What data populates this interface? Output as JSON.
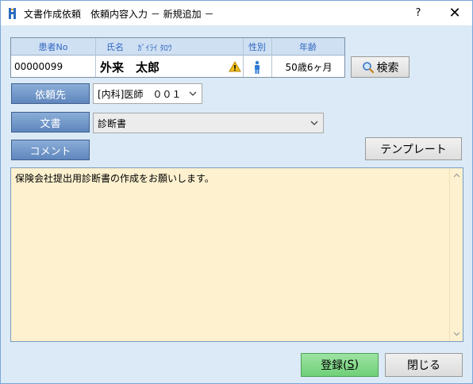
{
  "window": {
    "title": "文書作成依頼　依頼内容入力 － 新規追加 －",
    "help_label": "?",
    "close_label": "✕"
  },
  "patient": {
    "headers": {
      "no": "患者No",
      "name": "氏名",
      "kana": "ｶﾞｲﾗｲ ﾀﾛｳ",
      "sex": "性別",
      "age": "年齢"
    },
    "no": "00000099",
    "name": "外来　太郎",
    "age": "50歳6ヶ月"
  },
  "buttons": {
    "search": "検索",
    "requestee": "依頼先",
    "document": "文書",
    "comment": "コメント",
    "template": "テンプレート",
    "register": "登録(",
    "register_key": "S",
    "register_end": ")",
    "close": "閉じる"
  },
  "fields": {
    "requestee_value": "[内科]医師　００１",
    "document_value": "診断書",
    "comment_text": "保険会社提出用診断書の作成をお願いします。"
  },
  "colors": {
    "accent_blue": "#5f86bd",
    "memo_bg": "#fdf1cf",
    "ok_green": "#6fcf77",
    "window_bg": "#dbeaf6"
  }
}
